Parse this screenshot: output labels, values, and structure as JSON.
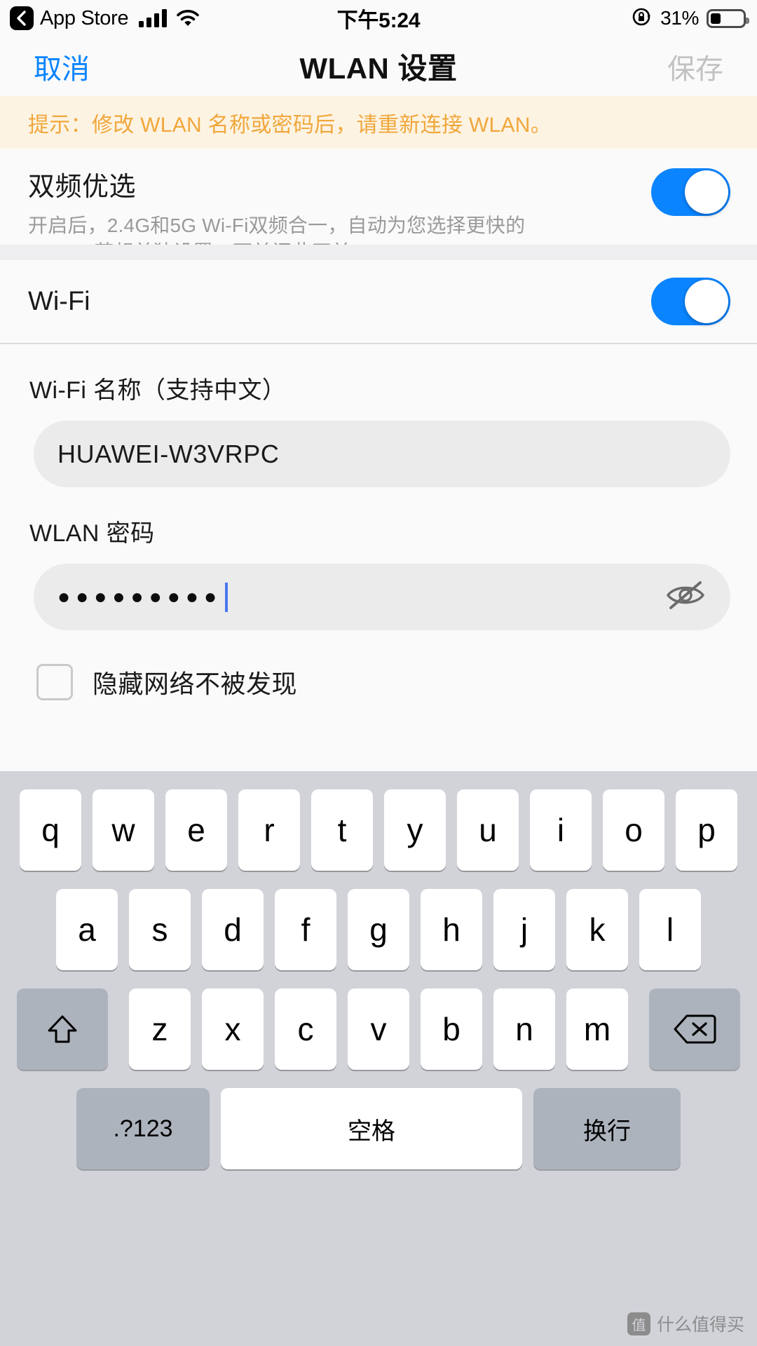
{
  "status_bar": {
    "back_app": "App Store",
    "back_icon": "chevron-left-icon",
    "signal_icon": "cellular-signal-icon",
    "wifi_icon": "wifi-icon",
    "time": "下午5:24",
    "rotation_lock_icon": "rotation-lock-icon",
    "battery_percent": "31%",
    "battery_level": 31
  },
  "nav_bar": {
    "cancel": "取消",
    "title": "WLAN 设置",
    "save": "保存",
    "cancel_color": "#0a84ff",
    "save_color": "#c2c2c2"
  },
  "tip_banner": {
    "text": "提示：修改 WLAN 名称或密码后，请重新连接 WLAN。",
    "text_color": "#f0a73c",
    "background": "#fdf3e2"
  },
  "dual_band": {
    "title": "双频优选",
    "desc_line1": "开启后，2.4G和5G Wi-Fi双频合一，自动为您选择更快的",
    "desc_line2": "Wi-Fi。若想单独设置，可关闭此开关。",
    "toggle_on": true,
    "toggle_color": "#0a84ff"
  },
  "wifi_row": {
    "label": "Wi-Fi",
    "toggle_on": true,
    "toggle_color": "#0a84ff"
  },
  "form": {
    "ssid_label": "Wi-Fi 名称（支持中文）",
    "ssid_value": "HUAWEI-W3VRPC",
    "password_label": "WLAN 密码",
    "password_masked": "●●●●●●●●●",
    "password_visibility_icon": "eye-off-icon",
    "hide_network_label": "隐藏网络不被发现",
    "hide_network_checked": false,
    "caret_color": "#4a76f0"
  },
  "keyboard": {
    "row1": [
      "q",
      "w",
      "e",
      "r",
      "t",
      "y",
      "u",
      "i",
      "o",
      "p"
    ],
    "row2": [
      "a",
      "s",
      "d",
      "f",
      "g",
      "h",
      "j",
      "k",
      "l"
    ],
    "row3": [
      "z",
      "x",
      "c",
      "v",
      "b",
      "n",
      "m"
    ],
    "shift_icon": "shift-arrow-icon",
    "backspace_icon": "backspace-icon",
    "numbers_key": ".?123",
    "space_key": "空格",
    "return_key": "换行"
  },
  "watermark": {
    "text": "什么值得买",
    "badge": "值"
  }
}
